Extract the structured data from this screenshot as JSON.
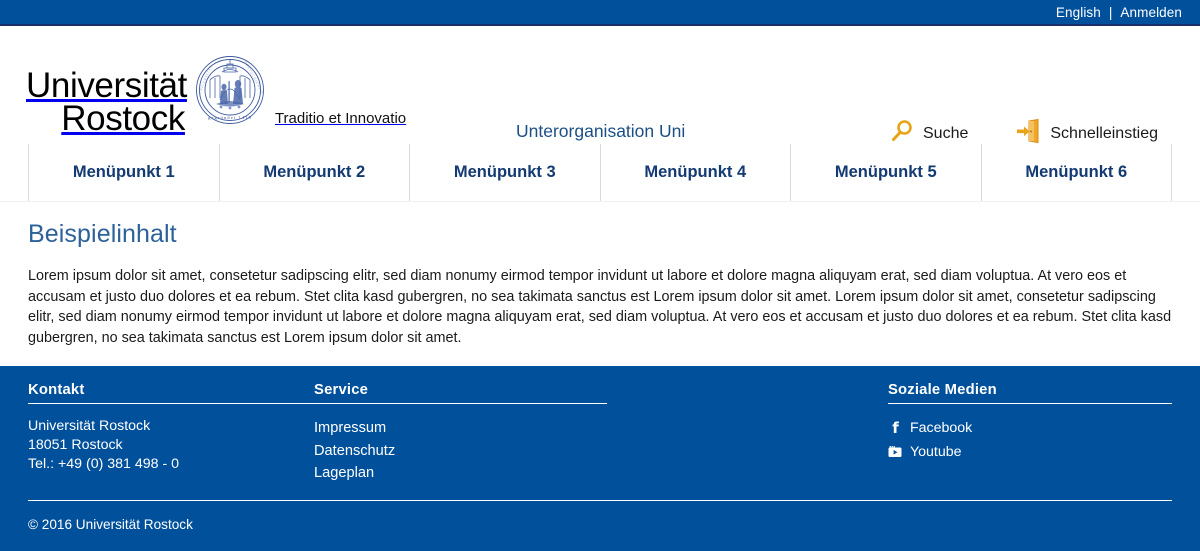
{
  "topbar": {
    "language_link": "English",
    "separator": "|",
    "login_link": "Anmelden"
  },
  "header": {
    "logo_line1": "Universität",
    "logo_line2": "Rostock",
    "seal_name": "university-seal",
    "seal_founded_text": "gegründet 1419",
    "tagline": "Traditio et Innovatio",
    "org_title": "Unterorganisation Uni",
    "actions": [
      {
        "label": "Suche",
        "icon": "search-icon",
        "color": "#e8a317"
      },
      {
        "label": "Schnelleinstieg",
        "icon": "door-enter-icon",
        "color": "#e8a317"
      }
    ]
  },
  "nav": {
    "items": [
      {
        "label": "Menüpunkt 1"
      },
      {
        "label": "Menüpunkt 2"
      },
      {
        "label": "Menüpunkt 3"
      },
      {
        "label": "Menüpunkt 4"
      },
      {
        "label": "Menüpunkt 5"
      },
      {
        "label": "Menüpunkt 6"
      }
    ]
  },
  "main": {
    "title": "Beispielinhalt",
    "paragraph": "Lorem ipsum dolor sit amet, consetetur sadipscing elitr, sed diam nonumy eirmod tempor invidunt ut labore et dolore magna aliquyam erat, sed diam voluptua. At vero eos et accusam et justo duo dolores et ea rebum. Stet clita kasd gubergren, no sea takimata sanctus est Lorem ipsum dolor sit amet. Lorem ipsum dolor sit amet, consetetur sadipscing elitr, sed diam nonumy eirmod tempor invidunt ut labore et dolore magna aliquyam erat, sed diam voluptua. At vero eos et accusam et justo duo dolores et ea rebum. Stet clita kasd gubergren, no sea takimata sanctus est Lorem ipsum dolor sit amet."
  },
  "footer": {
    "contact": {
      "heading": "Kontakt",
      "line1": "Universität Rostock",
      "line2": "18051 Rostock",
      "line3": "Tel.: +49 (0) 381 498 - 0"
    },
    "service": {
      "heading": "Service",
      "links": [
        {
          "label": "Impressum"
        },
        {
          "label": "Datenschutz"
        },
        {
          "label": "Lageplan"
        }
      ]
    },
    "social": {
      "heading": "Soziale Medien",
      "links": [
        {
          "label": "Facebook",
          "icon": "facebook-icon"
        },
        {
          "label": "Youtube",
          "icon": "youtube-icon"
        }
      ]
    },
    "copyright": "© 2016  Universität Rostock"
  },
  "colors": {
    "brand_blue": "#00509b",
    "dark_blue": "#1b2f6b",
    "nav_blue": "#133a72",
    "title_blue": "#2c6299",
    "accent_orange": "#e8a317"
  }
}
